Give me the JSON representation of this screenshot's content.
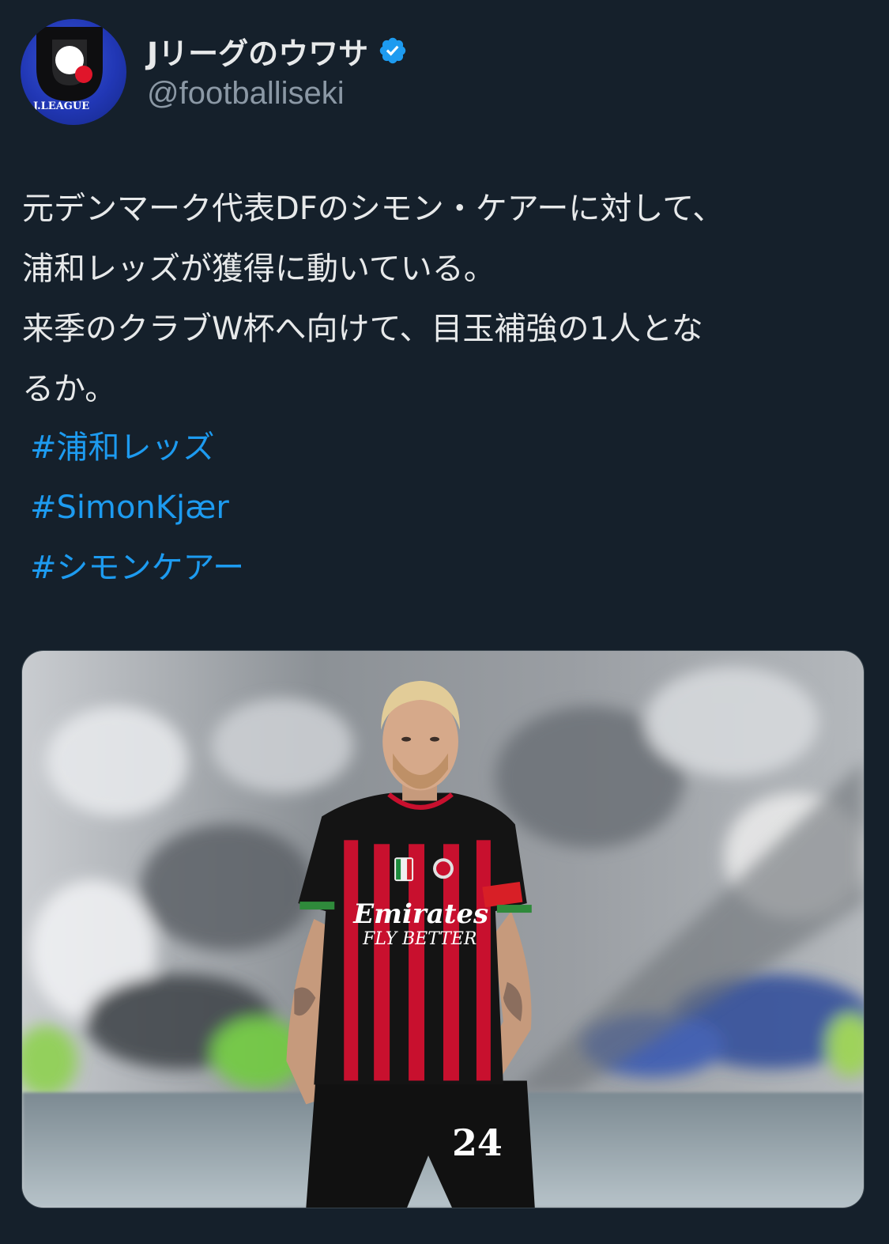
{
  "author": {
    "display_name": "Jリーグのウワサ",
    "handle": "@footballiseki",
    "avatar_text": "J.LEAGUE",
    "verified": true
  },
  "tweet": {
    "lines": [
      "元デンマーク代表DFのシモン・ケアーに対して、",
      "浦和レッズが獲得に動いている。",
      "来季のクラブW杯へ向けて、目玉補強の1人とな",
      "るか。"
    ],
    "hashtags": [
      "#浦和レッズ",
      "#SimonKjær",
      "#シモンケアー"
    ]
  },
  "media": {
    "alt": "photo",
    "shirt_sponsor": "Emirates",
    "shirt_tagline": "FLY BETTER",
    "shirt_number": "24"
  },
  "colors": {
    "background": "#15202b",
    "text": "#e7e9ea",
    "secondary": "#8b98a5",
    "link": "#1d9bf0",
    "verified": "#1d9bf0"
  }
}
